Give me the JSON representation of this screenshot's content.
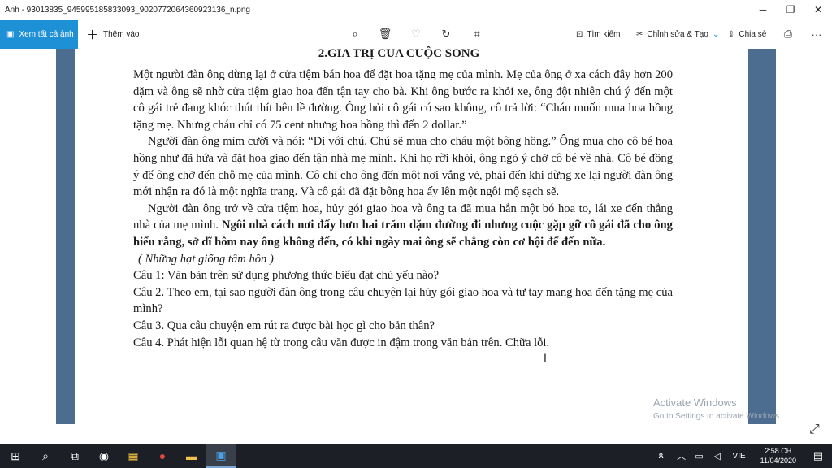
{
  "window": {
    "title": "Ảnh - 93013835_945995185833093_9020772064360923136_n.png",
    "minimize": "─",
    "maximize": "❐",
    "close": "✕"
  },
  "toolbar": {
    "see_all_label": "Xem tất cả ảnh",
    "add_label": "Thêm vào",
    "search_label": "Tìm kiếm",
    "edit_label": "Chỉnh sửa & Tạo",
    "share_label": "Chia sẻ",
    "more_label": "···"
  },
  "document": {
    "heading": "2.GIA TRỊ CUA CUỘC SONG",
    "p1": "Một người đàn ông dừng lại ở cửa tiệm bán hoa để đặt hoa tặng mẹ của mình. Mẹ của ông ở xa cách đây hơn 200 dặm và ông sẽ nhờ cửa tiệm giao hoa đến tận tay cho bà. Khi ông bước ra khỏi xe, ông đột nhiên chú ý đến một cô gái trẻ đang khóc thút thít bên lề đường. Ông hỏi cô gái có sao không, cô trả lời: “Cháu muốn mua hoa hồng tặng mẹ. Nhưng cháu chỉ có 75 cent nhưng hoa hồng thì đến 2 dollar.”",
    "p2": "Người đàn ông mỉm cười và nói: “Đi với chú. Chú sẽ mua cho cháu một bông hồng.” Ông mua cho cô bé hoa hồng như đã hứa và đặt hoa giao đến tận nhà mẹ mình. Khi họ rời khỏi, ông ngỏ ý chở cô bé về nhà. Cô bé đồng ý để ông chở đến chỗ mẹ của mình. Cô chỉ cho ông đến một nơi vắng vẻ, phải đến khi dừng xe lại người đàn ông mới nhận ra đó là một nghĩa trang. Và cô gái đã đặt bông hoa ấy lên một ngôi mộ sạch sẽ.",
    "p3_normal": "Người đàn ông trở về cửa tiệm hoa, hủy gói giao hoa và ông ta đã mua hẳn một bó hoa to, lái xe đến thẳng nhà của mẹ mình. ",
    "p3_bold": "Ngôi nhà cách nơi đấy hơn hai trăm dặm đường đi nhưng cuộc gặp gỡ cô gái đã cho ông hiểu rằng, sở dĩ hôm nay ông không đến, có khi ngày mai ông sẽ chẳng còn cơ hội để đến nữa.",
    "source": "( Những hạt giống tâm hồn )",
    "q1": "Câu 1: Văn bản trên sử dụng phương thức biểu đạt chủ yếu nào?",
    "q2": "Câu 2. Theo em, tại sao người đàn ông trong câu chuyện lại hủy gói giao hoa và tự tay mang hoa đến tặng mẹ của mình?",
    "q3": "Câu 3. Qua câu chuyện em rút ra được bài học gì cho bản thân?",
    "q4": "Câu 4. Phát hiện lỗi quan hệ từ trong câu văn được in đậm trong văn bản trên. Chữa lỗi."
  },
  "watermark": {
    "line1": "Activate Windows",
    "line2": "Go to Settings to activate Windows."
  },
  "taskbar": {
    "lang": "VIE",
    "time": "2:58 CH",
    "date": "11/04/2020"
  },
  "colors": {
    "accent": "#1e90d6",
    "image_bg": "#4c6d8f",
    "taskbar": "#1c2026"
  }
}
